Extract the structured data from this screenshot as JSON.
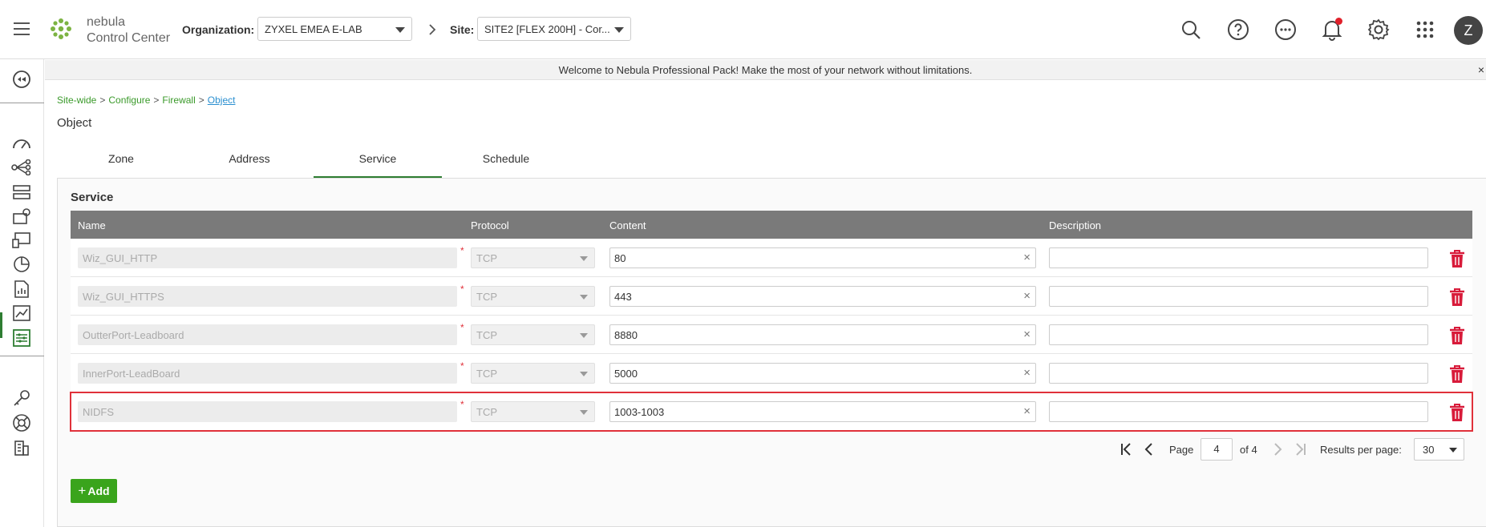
{
  "header": {
    "brand_line1": "nebula",
    "brand_line2": "Control Center",
    "org_label": "Organization:",
    "org_value": "ZYXEL EMEA E-LAB",
    "site_label": "Site:",
    "site_value": "SITE2 [FLEX 200H] - Cor...",
    "avatar_initial": "Z",
    "accent_color": "#3aa41c"
  },
  "banner": {
    "text": "Welcome to Nebula Professional Pack! Make the most of your network without limitations.",
    "close": "×"
  },
  "breadcrumb": {
    "items": [
      "Site-wide",
      "Configure",
      "Firewall",
      "Object"
    ],
    "separator": ">"
  },
  "page": {
    "title": "Object",
    "tabs": [
      "Zone",
      "Address",
      "Service",
      "Schedule"
    ],
    "active_tab": "Service"
  },
  "service": {
    "section_title": "Service",
    "columns": [
      "Name",
      "Protocol",
      "Content",
      "Description"
    ],
    "rows": [
      {
        "name": "Wiz_GUI_HTTP",
        "protocol": "TCP",
        "content": "80",
        "description": ""
      },
      {
        "name": "Wiz_GUI_HTTPS",
        "protocol": "TCP",
        "content": "443",
        "description": ""
      },
      {
        "name": "OutterPort-Leadboard",
        "protocol": "TCP",
        "content": "8880",
        "description": ""
      },
      {
        "name": "InnerPort-LeadBoard",
        "protocol": "TCP",
        "content": "5000",
        "description": ""
      },
      {
        "name": "NIDFS",
        "protocol": "TCP",
        "content": "1003-1003",
        "description": ""
      }
    ],
    "selected_row": 4,
    "required_mark": "*",
    "clear_glyph": "×"
  },
  "pagination": {
    "page_label": "Page",
    "page_value": "4",
    "of_label": "of 4",
    "rpp_label": "Results per page:",
    "rpp_value": "30"
  },
  "actions": {
    "add_label": "Add",
    "add_plus": "+"
  }
}
